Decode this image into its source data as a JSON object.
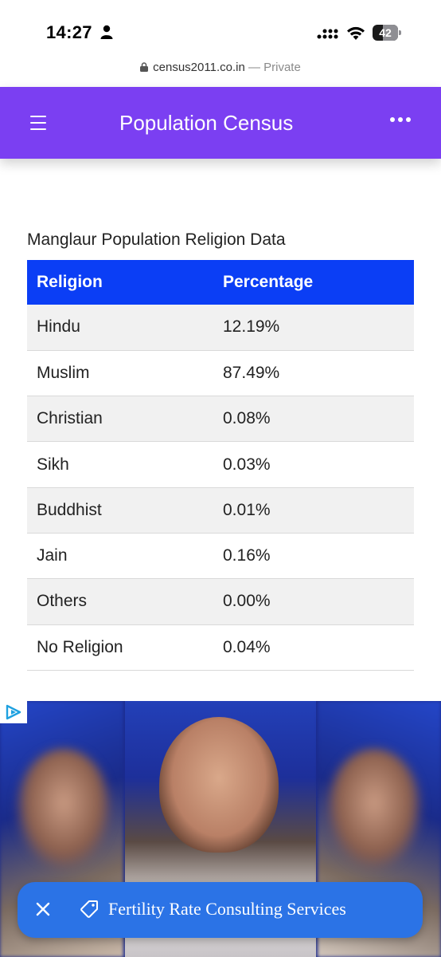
{
  "status_bar": {
    "time": "14:27",
    "battery": "42",
    "battery_level": 0.42
  },
  "browser": {
    "url": "census2011.co.in",
    "mode": "— Private"
  },
  "header": {
    "title": "Population Census",
    "menu_icon": "hamburger-icon",
    "more_icon": "more-dots-icon",
    "color": "#7b3ff2"
  },
  "section": {
    "title": "Manglaur Population Religion Data"
  },
  "table": {
    "header_color": "#0b3ef5",
    "columns": [
      "Religion",
      "Percentage"
    ],
    "rows": [
      {
        "religion": "Hindu",
        "percentage": "12.19%"
      },
      {
        "religion": "Muslim",
        "percentage": "87.49%"
      },
      {
        "religion": "Christian",
        "percentage": "0.08%"
      },
      {
        "religion": "Sikh",
        "percentage": "0.03%"
      },
      {
        "religion": "Buddhist",
        "percentage": "0.01%"
      },
      {
        "religion": "Jain",
        "percentage": "0.16%"
      },
      {
        "religion": "Others",
        "percentage": "0.00%"
      },
      {
        "religion": "No Religion",
        "percentage": "0.04%"
      }
    ]
  },
  "ad": {
    "choice_icon": "adchoices-icon"
  },
  "floating_bar": {
    "label": "Fertility Rate Consulting Services",
    "close_icon": "close-icon",
    "tag_icon": "tag-icon",
    "color": "#2b73e6"
  }
}
